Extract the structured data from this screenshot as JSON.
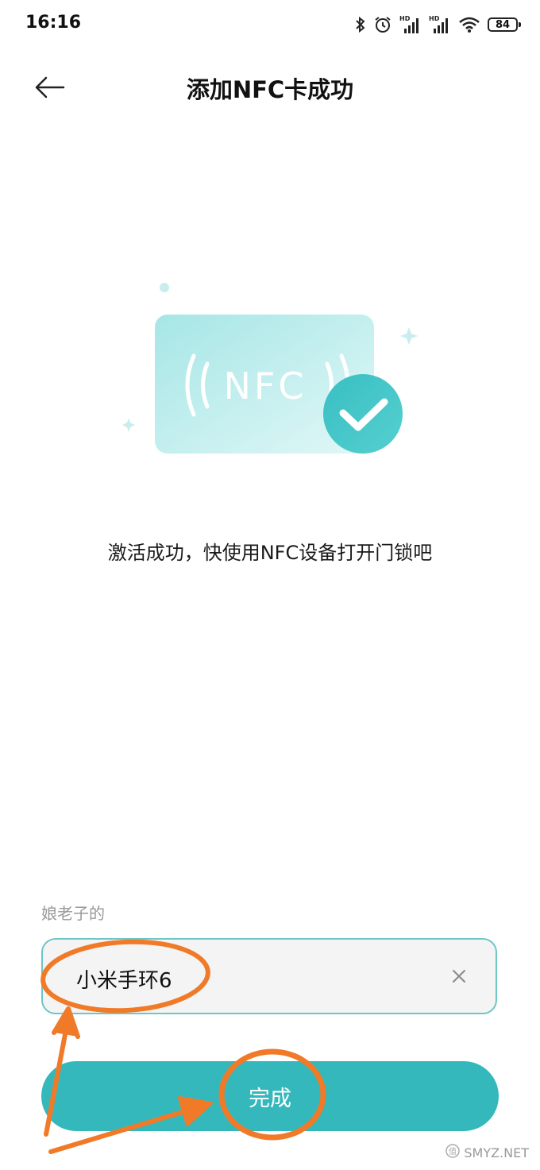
{
  "status_bar": {
    "time": "16:16",
    "battery": "84",
    "icons": [
      "bluetooth-icon",
      "alarm-icon",
      "hd-signal-icon",
      "hd-signal-icon",
      "wifi-icon",
      "battery-icon"
    ]
  },
  "header": {
    "title": "添加NFC卡成功",
    "back_icon": "arrow-left-icon"
  },
  "illustration": {
    "card_text": "NFC",
    "accent_color": "#3ec0c2",
    "card_color": "#bfeeef"
  },
  "message": "激活成功，快使用NFC设备打开门锁吧",
  "form": {
    "label": "娘老子的",
    "value": "小米手环6",
    "clear_icon": "close-icon"
  },
  "done_button": {
    "label": "完成",
    "color": "#34b8bb"
  },
  "annotation_color": "#f07a28",
  "watermark": "SMYZ.NET"
}
